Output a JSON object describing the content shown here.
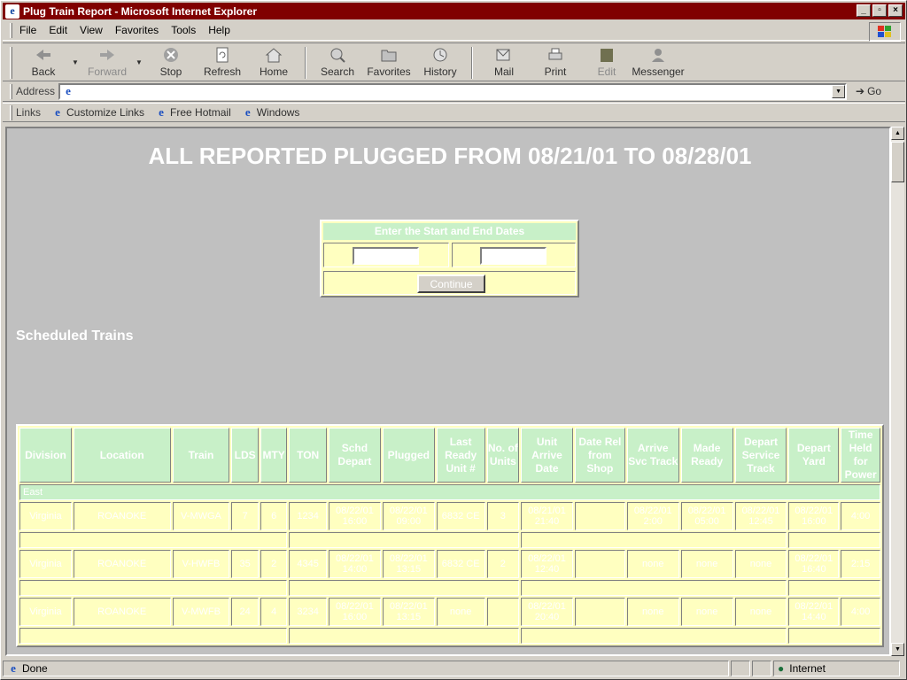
{
  "window": {
    "title": "Plug Train Report - Microsoft Internet Explorer"
  },
  "menu": [
    "File",
    "Edit",
    "View",
    "Favorites",
    "Tools",
    "Help"
  ],
  "toolbar": {
    "back": "Back",
    "forward": "Forward",
    "stop": "Stop",
    "refresh": "Refresh",
    "home": "Home",
    "search": "Search",
    "favorites": "Favorites",
    "history": "History",
    "mail": "Mail",
    "print": "Print",
    "edit": "Edit",
    "messenger": "Messenger"
  },
  "address": {
    "label": "Address",
    "value": "",
    "go": "Go"
  },
  "links": {
    "label": "Links",
    "items": [
      "Customize Links",
      "Free Hotmail",
      "Windows"
    ]
  },
  "page": {
    "title": "ALL REPORTED PLUGGED FROM 08/21/01 TO 08/28/01",
    "form": {
      "header": "Enter the Start and End Dates",
      "start": "",
      "end": "",
      "continue": "Continue"
    },
    "section": "Scheduled Trains"
  },
  "table": {
    "headers": [
      "Division",
      "Location",
      "Train",
      "LDS",
      "MTY",
      "TON",
      "Schd Depart",
      "Plugged",
      "Last Ready Unit #",
      "No. of Units",
      "Unit Arrive Date",
      "Date Rel from Shop",
      "Arrive Svc Track",
      "Made Ready",
      "Depart Service Track",
      "Depart Yard",
      "Time Held for Power"
    ],
    "groups": [
      {
        "name": "East",
        "row": [
          "Virginia",
          "ROANOKE",
          "V-MWGA",
          "7",
          "6",
          "1234",
          "08/22/01 16:00",
          "08/22/01 09:00",
          "6832 CE",
          "3",
          "08/21/01 21:40",
          "",
          "08/22/01 2:00",
          "08/22/01 05:00",
          "08/22/01 12:45",
          "08/22/01 16:00",
          "4:00"
        ]
      },
      {
        "name": "",
        "row": [
          "Virginia",
          "ROANOKE",
          "V-HWFB",
          "35",
          "2",
          "4345",
          "08/22/01 14:00",
          "08/22/01 13:15",
          "6832 CE",
          "2",
          "08/22/01 12:40",
          "",
          "none",
          "none",
          "none",
          "08/22/01 16:40",
          "2:15"
        ]
      },
      {
        "name": "",
        "row": [
          "Virginia",
          "ROANOKE",
          "V-MWFB",
          "24",
          "4",
          "3234",
          "08/22/01 16:00",
          "08/22/01 13:15",
          "none",
          "",
          "08/22/01 20:40",
          "",
          "none",
          "none",
          "none",
          "08/22/01 14:40",
          "4:00"
        ]
      },
      {
        "name": "",
        "row": []
      }
    ]
  },
  "status": {
    "text": "Done",
    "zone": "Internet"
  }
}
